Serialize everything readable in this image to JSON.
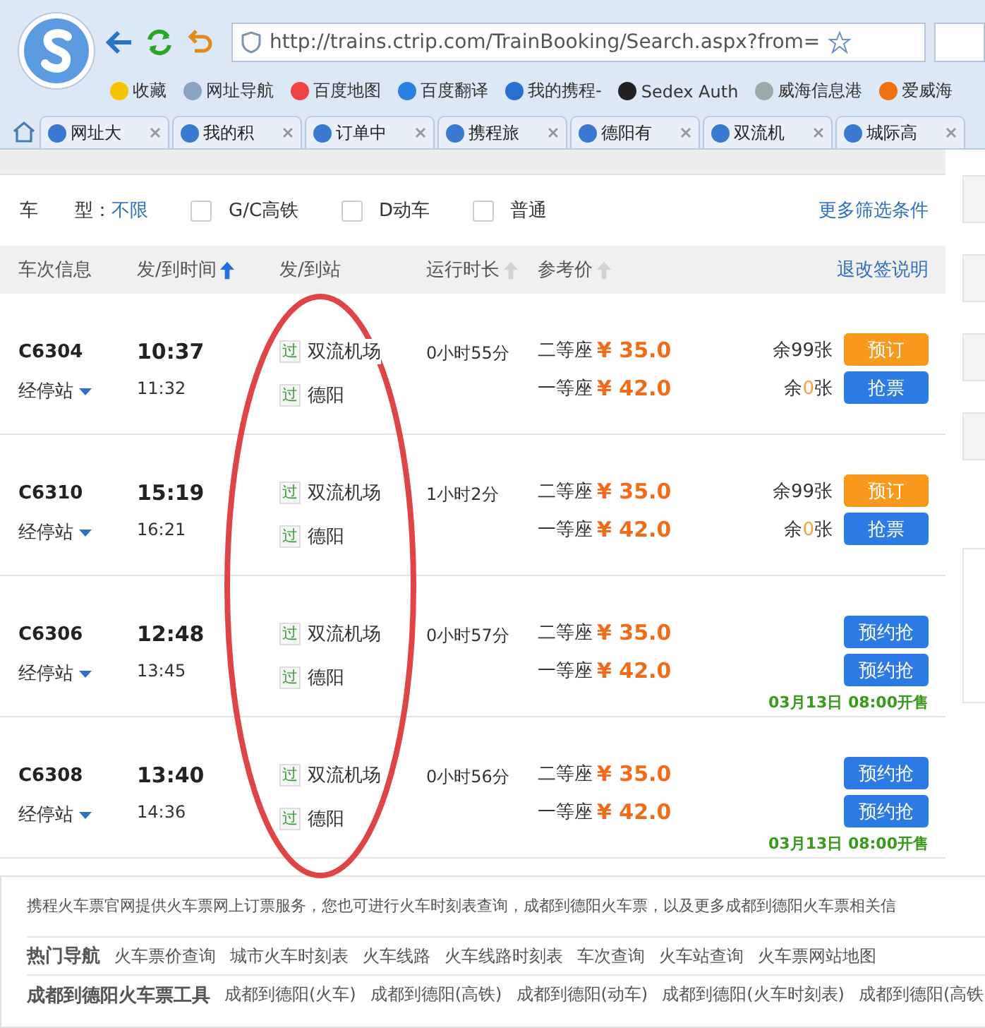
{
  "browser": {
    "url": "http://trains.ctrip.com/TrainBooking/Search.aspx?from=",
    "bookmarks": [
      "收藏",
      "网址导航",
      "百度地图",
      "百度翻译",
      "我的携程-",
      "Sedex Auth",
      "威海信息港",
      "爱威海"
    ],
    "tabs": [
      {
        "label": "网址大",
        "selected": false
      },
      {
        "label": "我的积",
        "selected": false
      },
      {
        "label": "订单中",
        "selected": false
      },
      {
        "label": "携程旅",
        "selected": false
      },
      {
        "label": "德阳有",
        "selected": false
      },
      {
        "label": "双流机",
        "selected": false
      },
      {
        "label": "城际高",
        "selected": false
      }
    ]
  },
  "filter": {
    "label_1": "车",
    "label_2": "型：",
    "all": "不限",
    "options": [
      {
        "label": "G/C高铁",
        "checked": false
      },
      {
        "label": "D动车",
        "checked": false
      },
      {
        "label": "普通",
        "checked": false
      }
    ],
    "more": "更多筛选条件"
  },
  "columns": [
    {
      "label": "车次信息",
      "kind": "header"
    },
    {
      "label": "发/到时间",
      "kind": "sortable",
      "sorted": true
    },
    {
      "label": "发/到站",
      "kind": "header"
    },
    {
      "label": "运行时长",
      "kind": "sortable",
      "sorted": false
    },
    {
      "label": "参考价",
      "kind": "sortable",
      "sorted": false
    },
    {
      "label": "退改签说明",
      "kind": "link"
    }
  ],
  "rows": [
    {
      "train": "C6304",
      "stops": "经停站",
      "depart": "10:37",
      "arrive": "11:32",
      "stations": [
        {
          "badge": "过",
          "name": "双流机场"
        },
        {
          "badge": "过",
          "name": "德阳"
        }
      ],
      "duration": "0小时55分",
      "seats": [
        {
          "class": "二等座",
          "price": "¥ 35.0",
          "remaining": {
            "before": "余",
            "count": "99",
            "after": "张",
            "low": false
          },
          "button": {
            "label": "预订",
            "kind": "book"
          }
        },
        {
          "class": "一等座",
          "price": "¥ 42.0",
          "remaining": {
            "before": "余",
            "count": "0",
            "after": "张",
            "low": true
          },
          "button": {
            "label": "抢票",
            "kind": "grab"
          }
        }
      ]
    },
    {
      "train": "C6310",
      "stops": "经停站",
      "depart": "15:19",
      "arrive": "16:21",
      "stations": [
        {
          "badge": "过",
          "name": "双流机场"
        },
        {
          "badge": "过",
          "name": "德阳"
        }
      ],
      "duration": "1小时2分",
      "seats": [
        {
          "class": "二等座",
          "price": "¥ 35.0",
          "remaining": {
            "before": "余",
            "count": "99",
            "after": "张",
            "low": false
          },
          "button": {
            "label": "预订",
            "kind": "book"
          }
        },
        {
          "class": "一等座",
          "price": "¥ 42.0",
          "remaining": {
            "before": "余",
            "count": "0",
            "after": "张",
            "low": true
          },
          "button": {
            "label": "抢票",
            "kind": "grab"
          }
        }
      ]
    },
    {
      "train": "C6306",
      "stops": "经停站",
      "depart": "12:48",
      "arrive": "13:45",
      "stations": [
        {
          "badge": "过",
          "name": "双流机场"
        },
        {
          "badge": "过",
          "name": "德阳"
        }
      ],
      "duration": "0小时57分",
      "seats": [
        {
          "class": "二等座",
          "price": "¥ 35.0",
          "button": {
            "label": "预约抢",
            "kind": "grab"
          }
        },
        {
          "class": "一等座",
          "price": "¥ 42.0",
          "button": {
            "label": "预约抢",
            "kind": "grab"
          }
        }
      ],
      "sale_note": "03月13日 08:00开售"
    },
    {
      "train": "C6308",
      "stops": "经停站",
      "depart": "13:40",
      "arrive": "14:36",
      "stations": [
        {
          "badge": "过",
          "name": "双流机场"
        },
        {
          "badge": "过",
          "name": "德阳"
        }
      ],
      "duration": "0小时56分",
      "seats": [
        {
          "class": "二等座",
          "price": "¥ 35.0",
          "button": {
            "label": "预约抢",
            "kind": "grab"
          }
        },
        {
          "class": "一等座",
          "price": "¥ 42.0",
          "button": {
            "label": "预约抢",
            "kind": "grab"
          }
        }
      ],
      "sale_note": "03月13日 08:00开售"
    }
  ],
  "footer": {
    "description": "携程火车票官网提供火车票网上订票服务，您也可进行火车时刻表查询，成都到德阳火车票，以及更多成都到德阳火车票相关信",
    "hot_nav": {
      "label": "热门导航",
      "links": [
        "火车票价查询",
        "城市火车时刻表",
        "火车线路",
        "火车线路时刻表",
        "车次查询",
        "火车站查询",
        "火车票网站地图"
      ]
    },
    "tools": {
      "label": "成都到德阳火车票工具",
      "links": [
        "成都到德阳(火车)",
        "成都到德阳(高铁)",
        "成都到德阳(动车)",
        "成都到德阳(火车时刻表)",
        "成都到德阳(高铁"
      ]
    }
  }
}
